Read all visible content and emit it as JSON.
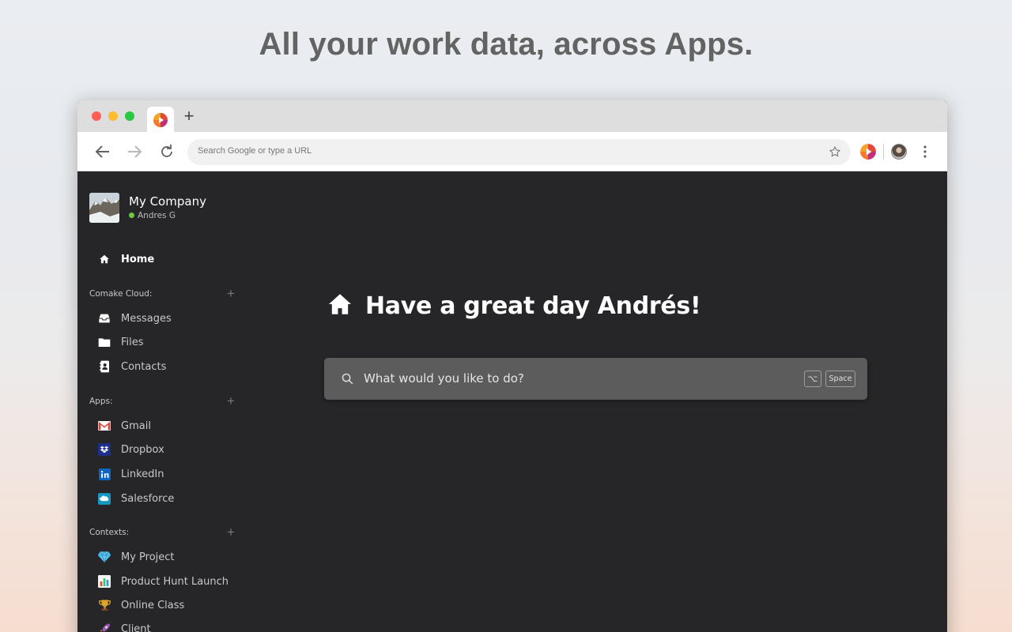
{
  "headline": "All your work data, across Apps.",
  "browser": {
    "new_tab": "+",
    "omnibox_placeholder": "Search Google or type a URL"
  },
  "sidebar": {
    "company": "My Company",
    "user": "Andres G",
    "home_label": "Home",
    "sections": [
      {
        "label": "Comake Cloud:",
        "add": "+",
        "items": [
          {
            "label": "Messages",
            "icon": "inbox-icon"
          },
          {
            "label": "Files",
            "icon": "folder-icon"
          },
          {
            "label": "Contacts",
            "icon": "contacts-book-icon"
          }
        ]
      },
      {
        "label": "Apps:",
        "add": "+",
        "items": [
          {
            "label": "Gmail",
            "icon": "gmail-icon"
          },
          {
            "label": "Dropbox",
            "icon": "dropbox-icon"
          },
          {
            "label": "LinkedIn",
            "icon": "linkedin-icon"
          },
          {
            "label": "Salesforce",
            "icon": "salesforce-icon"
          }
        ]
      },
      {
        "label": "Contexts:",
        "add": "+",
        "items": [
          {
            "label": "My Project",
            "icon": "gem-icon"
          },
          {
            "label": "Product Hunt Launch",
            "icon": "bar-chart-icon"
          },
          {
            "label": "Online Class",
            "icon": "trophy-icon"
          },
          {
            "label": "Client",
            "icon": "rocket-icon"
          }
        ]
      }
    ]
  },
  "main": {
    "greeting": "Have a great day Andrés!",
    "search_placeholder": "What would you like to do?",
    "shortcut_modifier": "⌥",
    "shortcut_key": "Space"
  },
  "colors": {
    "sidebar_bg": "#262528",
    "search_bg": "#5c5c5d",
    "online": "#6ecb3a",
    "gmail_red": "#d44638",
    "dropbox_blue": "#0061fe",
    "linkedin_blue": "#0a66c2",
    "salesforce_blue": "#1798c1"
  }
}
